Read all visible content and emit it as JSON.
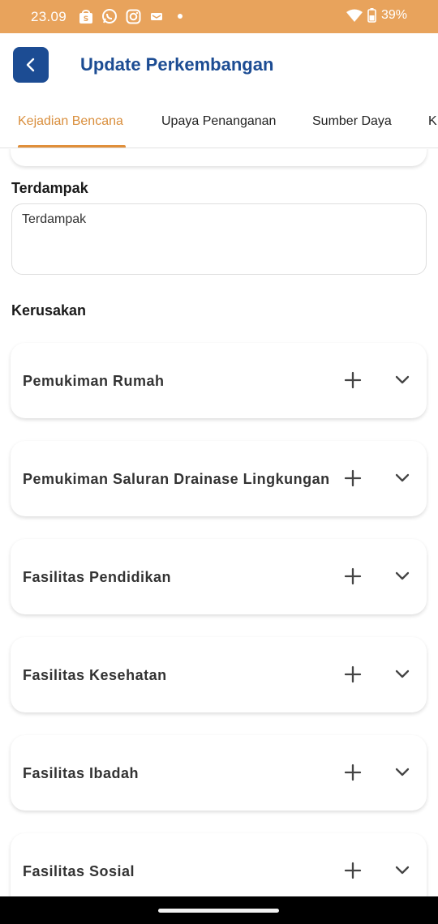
{
  "status_bar": {
    "time": "23.09",
    "battery": "39%",
    "icons": [
      "shopee-icon",
      "whatsapp-icon",
      "instagram-icon",
      "message-icon",
      "dot-icon",
      "wifi-icon",
      "battery-icon"
    ]
  },
  "app_bar": {
    "back_icon": "chevron-left-icon",
    "title": "Update Perkembangan"
  },
  "tabs": [
    {
      "label": "Kejadian Bencana",
      "active": true
    },
    {
      "label": "Upaya Penanganan",
      "active": false
    },
    {
      "label": "Sumber Daya",
      "active": false
    },
    {
      "label": "K",
      "active": false
    }
  ],
  "colors": {
    "status_bar": "#e8a35c",
    "primary": "#1c4c93",
    "tab_active": "#d98e3c"
  },
  "terdampak": {
    "label": "Terdampak",
    "value": "Terdampak"
  },
  "kerusakan": {
    "label": "Kerusakan",
    "items": [
      {
        "title": "Pemukiman Rumah"
      },
      {
        "title": "Pemukiman Saluran Drainase Lingkungan"
      },
      {
        "title": "Fasilitas Pendidikan"
      },
      {
        "title": "Fasilitas Kesehatan"
      },
      {
        "title": "Fasilitas Ibadah"
      },
      {
        "title": "Fasilitas Sosial"
      }
    ]
  }
}
